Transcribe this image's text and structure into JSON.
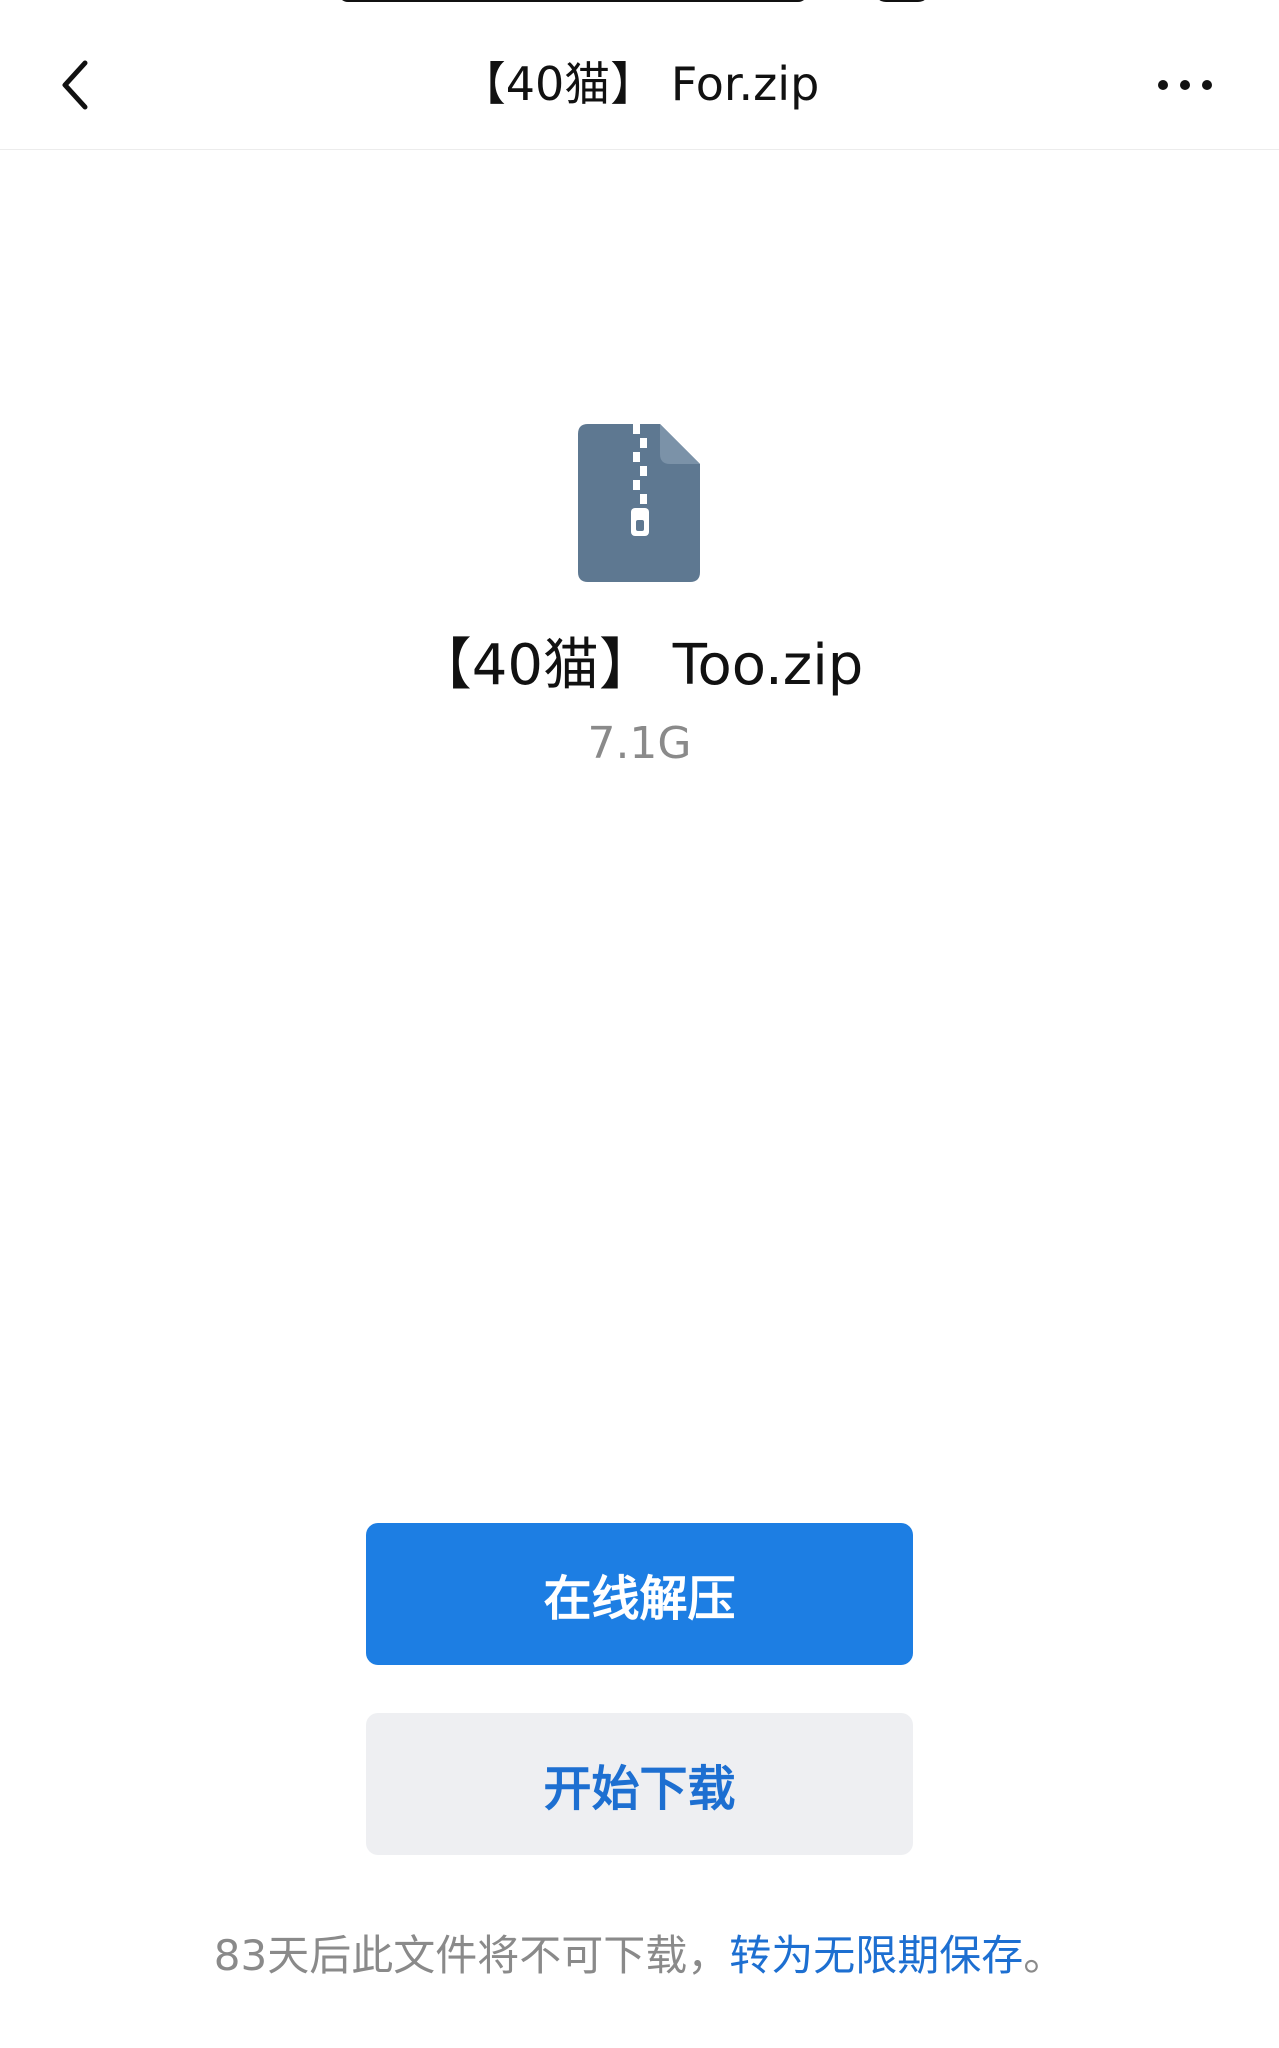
{
  "nav": {
    "title": "【40猫】 For.zip",
    "back_icon": "chevron-left-icon",
    "more_icon": "more-horizontal-icon"
  },
  "file": {
    "icon": "zip-file-icon",
    "icon_color": "#5e7891",
    "name": "【40猫】 Too.zip",
    "size": "7.1G"
  },
  "actions": {
    "online_extract_label": "在线解压",
    "download_label": "开始下载"
  },
  "footer": {
    "notice": "83天后此文件将不可下载，",
    "link": "转为无限期保存",
    "period": "。"
  },
  "colors": {
    "primary": "#1d7ee3",
    "link": "#1d6fd1",
    "secondary_bg": "#eeeff2",
    "muted_text": "#8a8a8a"
  }
}
